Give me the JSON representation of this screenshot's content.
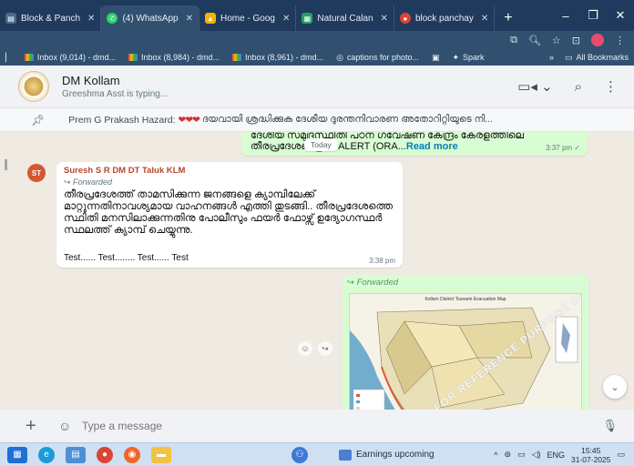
{
  "browser": {
    "tabs": [
      {
        "label": "Block & Panch",
        "icon": "doc-icon",
        "color": "#4c6b8f"
      },
      {
        "label": "(4) WhatsApp",
        "icon": "whatsapp-icon",
        "color": "#25d366"
      },
      {
        "label": "Home - Goog",
        "icon": "drive-icon",
        "color": "#f5b400"
      },
      {
        "label": "Natural Calan",
        "icon": "sheets-icon",
        "color": "#1fa463"
      },
      {
        "label": "block panchay",
        "icon": "chrome-icon",
        "color": "#db4437"
      }
    ],
    "new_tab": "+",
    "bookmarks": [
      {
        "label": "Inbox (9,014) - dmd..."
      },
      {
        "label": "Inbox (8,984) - dmd..."
      },
      {
        "label": "Inbox (8,961) - dmd..."
      },
      {
        "label": "captions for photo..."
      },
      {
        "label": "Spark"
      }
    ],
    "bookmarks_more": "»",
    "all_bookmarks": "All Bookmarks"
  },
  "chat": {
    "name": "DM Kollam",
    "status": "Greeshma Asst is typing...",
    "pinned": {
      "author": "Prem G Prakash Hazard:",
      "hearts": "❤❤❤",
      "text": "ദയവായി ശ്രദ്ധിക്കുക ദേശീയ ദുരന്തനിവാരണ അതോറിറ്റിയുടെ നി..."
    }
  },
  "messages": {
    "out1": {
      "text": "ദേശീയ സമുദ്രസ്ഥിതി പഠന ഗവേഷണ കേന്ദ്രം കേരളത്തിലെ തീരപ്രദേശങ്ങളിൽ ALERT (ORA...",
      "read_more": "Read more",
      "time": "3:37 pm ✓"
    },
    "date_chip": "Today",
    "in1": {
      "avatar": "ST",
      "sender": "Suresh S R DM DT Taluk KLM",
      "forwarded": "Forwarded",
      "text": "തീരപ്രദേശത്ത് താമസിക്കുന്ന ജനങ്ങളെ ക്യാമ്പിലേക്ക് മാറ്റുന്നതിനാവശ്യമായ വാഹനങ്ങൾ എത്തി തുടങ്ങി.. തീരപ്രദേശത്തെ സ്ഥിതി മനസിലാക്കുന്നതിനു പോലീസും ഫയർ ഫോഴ്സ് ഉദ്യോഗസ്ഥർ സ്ഥലത്ത് ക്യാമ്പ് ചെയ്യുന്നു.",
      "test_text": "Test...... Test........ Test...... Test",
      "time": "3:38 pm"
    },
    "out2": {
      "forwarded": "Forwarded",
      "map_title": "Kollam District Tsunami Evacuation Map",
      "watermark": "FOR REFERENCE PURPOSE ONLY"
    }
  },
  "composer": {
    "placeholder": "Type a message"
  },
  "taskbar": {
    "news": "Earnings upcoming",
    "lang": "ENG",
    "time": "15:45",
    "date": "31-07-2025"
  }
}
